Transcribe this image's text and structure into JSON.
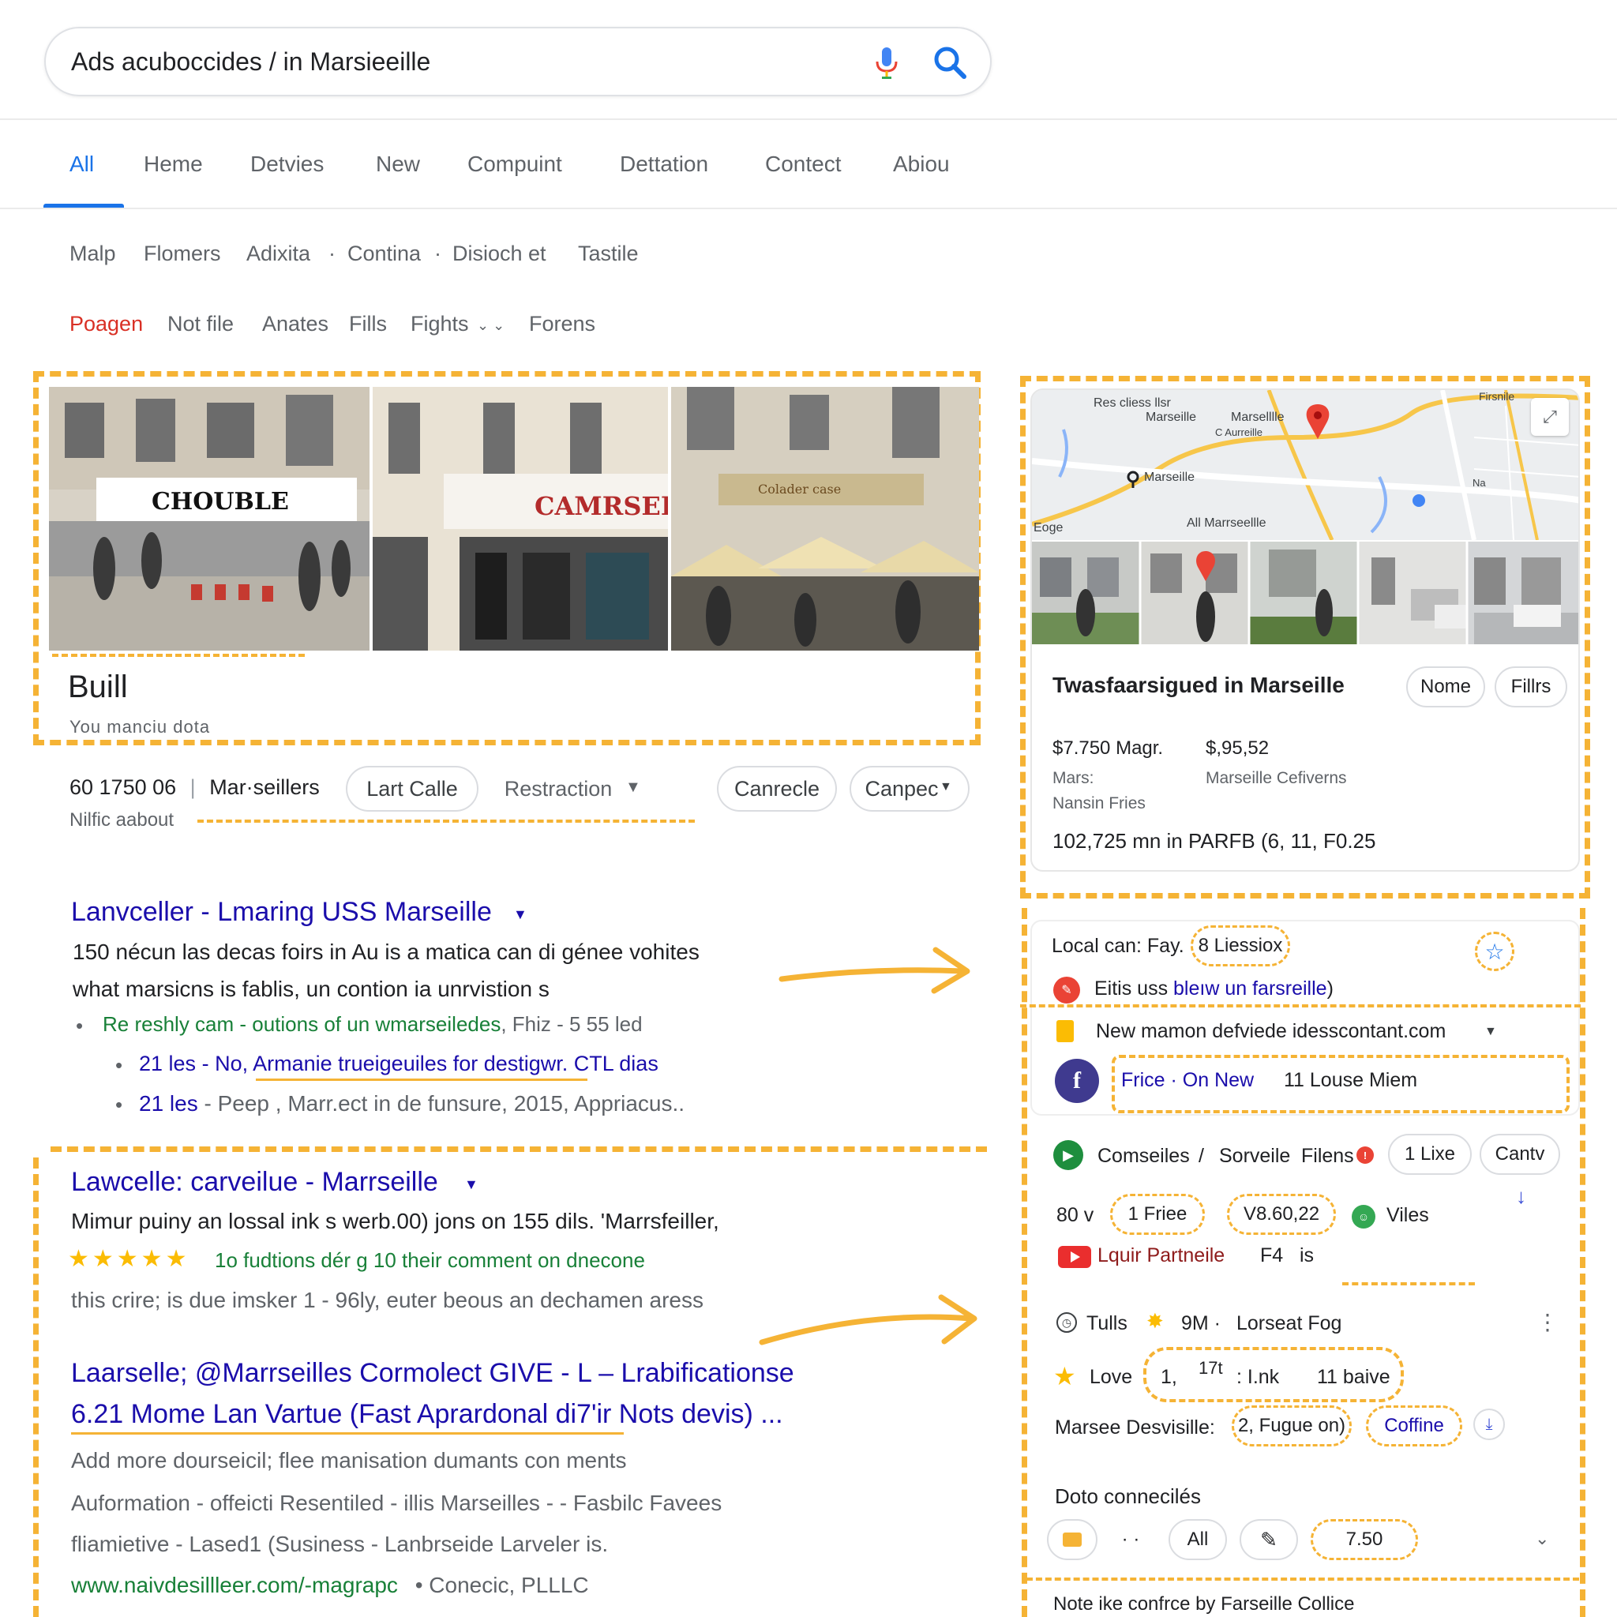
{
  "search": {
    "query": "Ads   acuboccides / in Marsieeille"
  },
  "tabs": [
    {
      "label": "All"
    },
    {
      "label": "Heme"
    },
    {
      "label": "Detvies"
    },
    {
      "label": "New"
    },
    {
      "label": "Compuint"
    },
    {
      "label": "Dettation"
    },
    {
      "label": "Contect"
    },
    {
      "label": "Abiou"
    }
  ],
  "filters1": [
    "Malp",
    "Flomers",
    "Adixita",
    "Contina",
    "Disioch et",
    "Tastile"
  ],
  "filters2": [
    "Poagen",
    "Not file",
    "Anates",
    "Fills",
    "Fights",
    "Forens"
  ],
  "entity": {
    "photos": [
      {
        "sign": "CHOUBLE"
      },
      {
        "sign": "CAMRSEILE"
      },
      {
        "sign": "Colader case"
      }
    ],
    "title": "Buill",
    "subtitle": "You manciu dota",
    "phone": "60  1750 06",
    "location": "Mar·seillers",
    "note": "Nilfic aabout",
    "buttons": [
      "Lart Calle",
      "Restraction",
      "Canrecle",
      "Canpec"
    ]
  },
  "results": [
    {
      "title": "Lanvceller - Lmaring USS Marseille",
      "line1": "150 nécun las decas foirs in Au is a matica can di génee vohites",
      "line2": "what marsicns is fablis, un contion ia unrvistion s",
      "green": "Re reshly cam - outions of un wmarseiledes",
      "green_meta": ", Fhiz - 5 55 led",
      "sub1_num": "21 les",
      "sub1_text": "- No, Armanie trueigeuiles for destigwr. CTL dias",
      "sub2_num": "21 les",
      "sub2_text": "- Peep ,  Marr.ect in de funsure, 2015, Appriacus.."
    },
    {
      "title": "Lawcelle: carveilue - Marrseille",
      "line1": "Mimur puiny an lossal ink s werb.00) jons on 155 dils. 'Marrsfeiller,",
      "rating": "★★★★★",
      "rating_text": "1o fudtions dér g  10 their comment on dnecone",
      "line2": "this crire; is due imsker 1 - 96ly, euter beous an dechamen aress"
    },
    {
      "title1": "Laarselle; @Marrseilles Cormolect GIVE  -  L – Lrabificationse",
      "title2": "6.21 Mome Lan Vartue (Fast Aprardonal di7'ir Nots devis) ...",
      "line1": "Add more dourseicil; flee manisation dumants con ments",
      "line2": "Auformation - offeicti Resentiled - illis Marseilles - - Fasbilc Favees",
      "line3": "fliamietive - Lased1 (Susiness - Lanbrseide Larveler is.",
      "url": "www.naivdesillleer.com/-magrapc",
      "url_meta": "•  Conecic, PLLLC"
    }
  ],
  "knowledge": {
    "map_labels": [
      "Res cliess llsr",
      "Marseille",
      "Marselllle",
      "C Aurreille",
      "Marseille",
      "All Marrseellle",
      "Firsnile",
      "Na",
      "Eoge"
    ],
    "title": "Twasfaarsigued in Marseille",
    "btn1": "Nome",
    "btn2": "Fillrs",
    "price1": "$7.750 Magr.",
    "price2": "$,95,52",
    "label1": "Mars:",
    "label2": "Marseille Cefiverns",
    "label3": "Nansin Fries",
    "summary": "102,725 mn in PARFB (6, 11, F0.25"
  },
  "side": {
    "local": "Local can: Fay.",
    "local_badge": "8 Liessiox",
    "link_prefix": "Eitis uss ",
    "link": "bleıw un farsreille",
    "link_suffix": ")",
    "website": "New mamon defviede idesscontant.com",
    "fb_text": "Frice · On New",
    "fb_meta": "11 Louse Miem",
    "row1": [
      "Comseiles",
      "/",
      "Sorveile",
      "Filens"
    ],
    "row1_pills": [
      "1 Lixe",
      "Cantv"
    ],
    "row2": [
      "80  v",
      "1 Friee",
      "V8.60,22",
      "Viles"
    ],
    "yt_link": "Lquir Partneile",
    "yt_meta": "F4",
    "yt_meta2": "is",
    "row3": [
      "Tulls",
      "9M ·",
      "Lorseat Fog"
    ],
    "row4": [
      "Love",
      "1,",
      "17t",
      ": I.nk",
      "11 baive"
    ],
    "row5_label": "Marsee Desvisille:",
    "row5_val": "2, Fugue on)",
    "row5_link": "Coffine",
    "section": "Doto connecilés",
    "bottom_pills": [
      "· ·",
      "All",
      "7.50"
    ],
    "footer": "Note ike confrce by Farseille  Collice"
  },
  "colors": {
    "accent_blue": "#1a73e8",
    "link_blue": "#1a0dab",
    "green": "#188038",
    "highlight": "#f5b335",
    "red": "#d93025"
  }
}
